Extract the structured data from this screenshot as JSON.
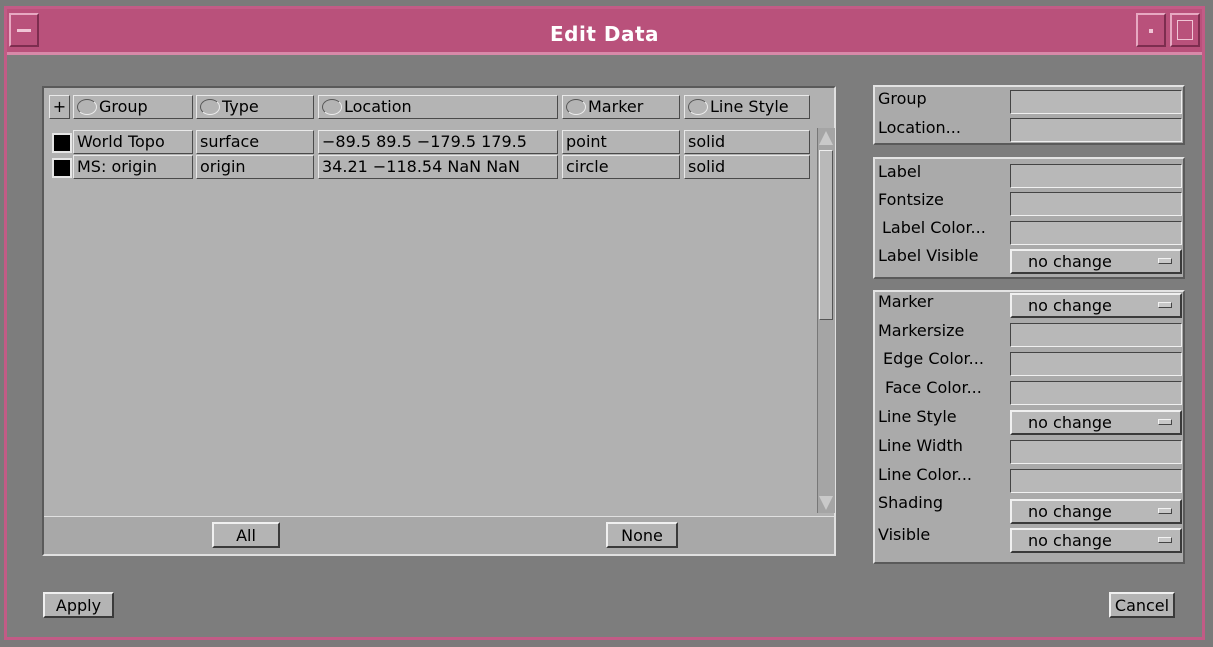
{
  "window": {
    "title": "Edit Data"
  },
  "list": {
    "plus_label": "+",
    "columns": [
      "Group",
      "Type",
      "Location",
      "Marker",
      "Line Style"
    ],
    "rows": [
      {
        "group": "World Topo",
        "type": "surface",
        "location": "−89.5 89.5 −179.5 179.5",
        "marker": "point",
        "line_style": "solid"
      },
      {
        "group": "MS: origin",
        "type": "origin",
        "location": "34.21 −118.54 NaN NaN",
        "marker": "circle",
        "line_style": "solid"
      }
    ],
    "all_button": "All",
    "none_button": "None"
  },
  "props": {
    "group_label": "Group",
    "location_label": "Location...",
    "label_label": "Label",
    "fontsize_label": "Fontsize",
    "label_color_label": "Label Color...",
    "label_visible_label": "Label Visible",
    "label_visible_value": "no change",
    "marker_label": "Marker",
    "marker_value": "no change",
    "markersize_label": "Markersize",
    "edge_color_label": "Edge Color...",
    "face_color_label": "Face Color...",
    "line_style_label": "Line Style",
    "line_style_value": "no change",
    "line_width_label": "Line Width",
    "line_color_label": "Line Color...",
    "shading_label": "Shading",
    "shading_value": "no change",
    "visible_label": "Visible",
    "visible_value": "no change"
  },
  "footer": {
    "apply_button": "Apply",
    "cancel_button": "Cancel"
  },
  "colors": {
    "titlebar": "#b9517b",
    "window_border": "#c25b86",
    "background": "#7d7d7d",
    "swatch": "#000000"
  },
  "icons": {
    "window_menu": "window-menu-icon",
    "minimize": "minimize-icon",
    "maximize": "maximize-icon",
    "scroll_up": "scroll-up-arrow-icon",
    "scroll_down": "scroll-down-arrow-icon",
    "dropdown": "option-menu-indicator-icon"
  }
}
